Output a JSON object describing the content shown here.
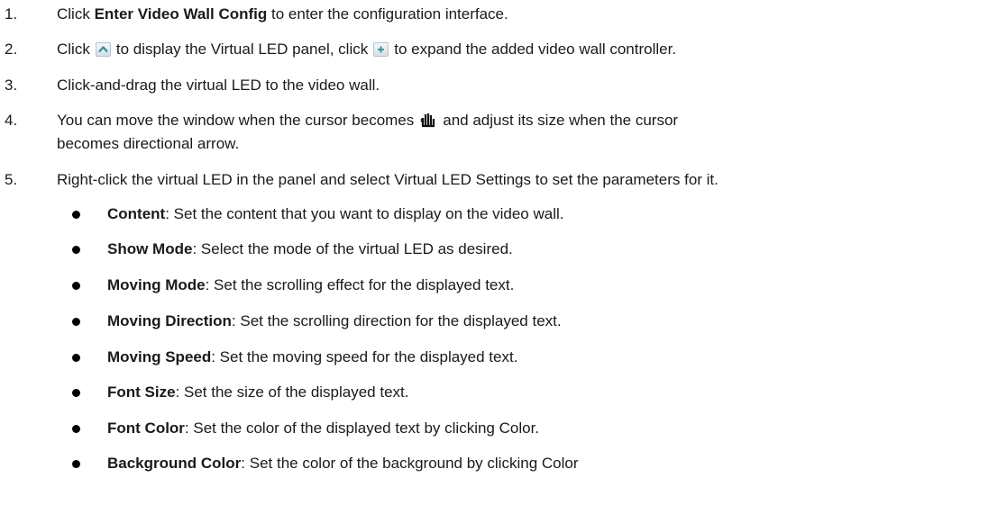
{
  "steps": [
    {
      "num": "1.",
      "pre": "Click ",
      "bold": "Enter Video Wall Config",
      "post": " to enter the configuration interface."
    },
    {
      "num": "2.",
      "a": "Click",
      "b": "to display the Virtual LED panel, click",
      "c": "to expand the added video wall controller."
    },
    {
      "num": "3.",
      "text": "Click-and-drag the virtual LED to the video wall."
    },
    {
      "num": "4.",
      "a": "You can move the window when the cursor becomes",
      "b": "and adjust its size when the cursor",
      "c": "becomes directional arrow."
    },
    {
      "num": "5.",
      "text": "Right-click the virtual LED in the panel and select Virtual LED Settings to set the parameters for it."
    }
  ],
  "bullets": [
    {
      "term": "Content",
      "desc": ": Set the content that you want to display on the video wall."
    },
    {
      "term": "Show Mode",
      "desc": ": Select the mode of the virtual LED as desired."
    },
    {
      "term": "Moving Mode",
      "desc": ": Set the scrolling effect for the displayed text."
    },
    {
      "term": "Moving Direction",
      "desc": ": Set the scrolling direction for the displayed text."
    },
    {
      "term": "Moving Speed",
      "desc": ": Set the moving speed for the displayed text."
    },
    {
      "term": "Font Size",
      "desc": ": Set the size of the displayed text."
    },
    {
      "term": "Font Color",
      "desc": ": Set the color of the displayed text by clicking Color."
    },
    {
      "term": "Background Color",
      "desc": ": Set the color of the background by clicking Color"
    }
  ],
  "icons": {
    "expand_panel": "chevron-up-icon",
    "expand_controller": "plus-icon",
    "move_cursor": "hand-move-cursor-icon"
  },
  "colors": {
    "text": "#1a1a1a",
    "icon_teal": "#2f8f9c",
    "icon_border": "#b9c3cc"
  }
}
